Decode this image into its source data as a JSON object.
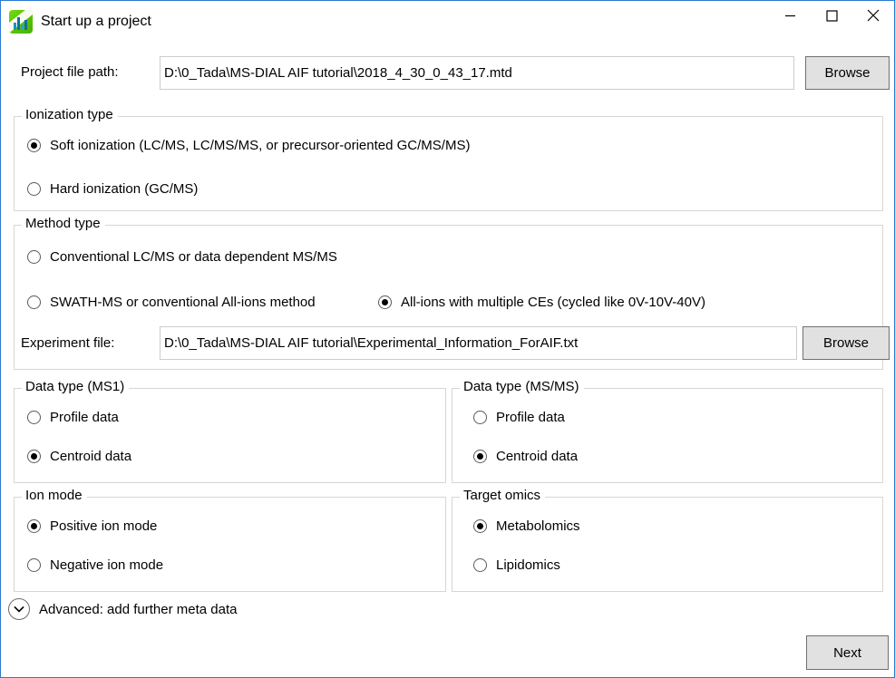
{
  "window": {
    "title": "Start up a project",
    "icon": "msdial-app-icon",
    "accent_border": "#2a7ad0",
    "controls": {
      "minimize": "minimize-icon",
      "maximize": "maximize-icon",
      "close": "close-icon"
    }
  },
  "project_file": {
    "label": "Project file path:",
    "value": "D:\\0_Tada\\MS-DIAL AIF tutorial\\2018_4_30_0_43_17.mtd",
    "placeholder": "",
    "browse_label": "Browse"
  },
  "ionization_type": {
    "title": "Ionization type",
    "options": [
      {
        "label": "Soft ionization (LC/MS, LC/MS/MS, or precursor-oriented GC/MS/MS)",
        "checked": true
      },
      {
        "label": "Hard ionization (GC/MS)",
        "checked": false
      }
    ]
  },
  "method_type": {
    "title": "Method type",
    "options": [
      {
        "label": "Conventional LC/MS or data dependent MS/MS",
        "checked": false
      },
      {
        "label": "SWATH-MS or conventional All-ions method",
        "checked": false
      },
      {
        "label": "All-ions with multiple CEs (cycled like 0V-10V-40V)",
        "checked": true
      }
    ],
    "experiment_file": {
      "label": "Experiment file:",
      "value": "D:\\0_Tada\\MS-DIAL AIF tutorial\\Experimental_Information_ForAIF.txt",
      "placeholder": "",
      "browse_label": "Browse"
    }
  },
  "data_type_ms1": {
    "title": "Data type (MS1)",
    "options": [
      {
        "label": "Profile data",
        "checked": false
      },
      {
        "label": "Centroid data",
        "checked": true
      }
    ]
  },
  "data_type_msms": {
    "title": "Data type (MS/MS)",
    "options": [
      {
        "label": "Profile data",
        "checked": false
      },
      {
        "label": "Centroid data",
        "checked": true
      }
    ]
  },
  "ion_mode": {
    "title": "Ion mode",
    "options": [
      {
        "label": "Positive ion mode",
        "checked": true
      },
      {
        "label": "Negative ion mode",
        "checked": false
      }
    ]
  },
  "target_omics": {
    "title": "Target omics",
    "options": [
      {
        "label": "Metabolomics",
        "checked": true
      },
      {
        "label": "Lipidomics",
        "checked": false
      }
    ]
  },
  "advanced": {
    "label": "Advanced: add further meta data",
    "icon": "chevron-down-icon"
  },
  "footer": {
    "next_label": "Next"
  }
}
